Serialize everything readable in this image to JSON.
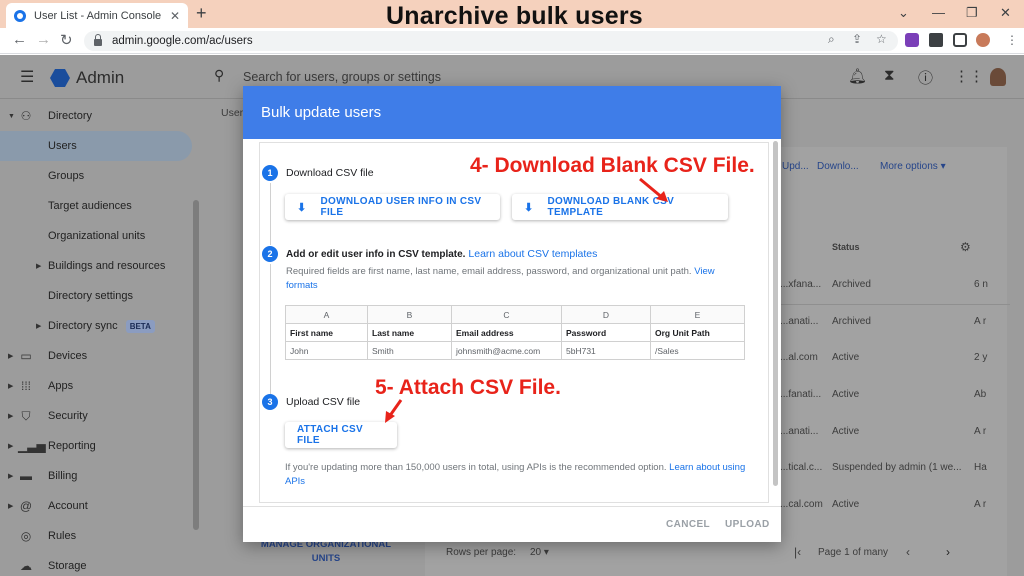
{
  "browser": {
    "tab_title": "User List - Admin Console",
    "new_tab": "+",
    "url": "admin.google.com/ac/users",
    "headline": "Unarchive bulk users",
    "win_min": "⌄",
    "win_minimize": "—",
    "win_restore": "❐",
    "win_close": "✕",
    "tab_close": "✕"
  },
  "admin": {
    "brand": "Admin",
    "search_placeholder": "Search for users, groups or settings"
  },
  "sidebar": {
    "items": [
      {
        "label": "Directory"
      },
      {
        "label": "Users"
      },
      {
        "label": "Groups"
      },
      {
        "label": "Target audiences"
      },
      {
        "label": "Organizational units"
      },
      {
        "label": "Buildings and resources"
      },
      {
        "label": "Directory settings"
      },
      {
        "label": "Directory sync",
        "badge": "BETA"
      },
      {
        "label": "Devices"
      },
      {
        "label": "Apps"
      },
      {
        "label": "Security"
      },
      {
        "label": "Reporting"
      },
      {
        "label": "Billing"
      },
      {
        "label": "Account"
      },
      {
        "label": "Rules"
      },
      {
        "label": "Storage"
      }
    ]
  },
  "background": {
    "users_tab": "User",
    "upd": "Upd...",
    "downlo": "Downlo...",
    "more_options": "More options",
    "status_header": "Status",
    "rows": [
      {
        "email": "...xfana...",
        "status": "Archived",
        "last": "6 n"
      },
      {
        "email": "...anati...",
        "status": "Archived",
        "last": "A r"
      },
      {
        "email": "...al.com",
        "status": "Active",
        "last": "2 y"
      },
      {
        "email": "...fanati...",
        "status": "Active",
        "last": "Ab"
      },
      {
        "email": "...anati...",
        "status": "Active",
        "last": "A r"
      },
      {
        "email": "...tical.c...",
        "status": "Suspended by admin (1 we...",
        "last": "Ha"
      },
      {
        "email": "...cal.com",
        "status": "Active",
        "last": "A r"
      }
    ],
    "manage_ou": "MANAGE ORGANIZATIONAL UNITS",
    "rows_per_page_label": "Rows per page:",
    "rows_per_page_value": "20",
    "pagination": "Page 1 of many"
  },
  "dialog": {
    "title": "Bulk update users",
    "step1": {
      "number": "1",
      "title": "Download CSV file",
      "btn_user_info": "DOWNLOAD USER INFO IN CSV FILE",
      "btn_blank": "DOWNLOAD BLANK CSV TEMPLATE"
    },
    "step2": {
      "number": "2",
      "title": "Add or edit user info in CSV template.",
      "link": "Learn about CSV templates",
      "required_text": "Required fields are first name, last name, email address, password, and organizational unit path.",
      "view_link": "View",
      "formats_link": "formats",
      "table": {
        "letters": [
          "A",
          "B",
          "C",
          "D",
          "E"
        ],
        "headers": [
          "First name",
          "Last name",
          "Email address",
          "Password",
          "Org Unit Path"
        ],
        "sample": [
          "John",
          "Smith",
          "johnsmith@acme.com",
          "5bH731",
          "/Sales"
        ]
      }
    },
    "step3": {
      "number": "3",
      "title": "Upload CSV file",
      "btn_attach": "ATTACH CSV FILE",
      "api_text": "If you're updating more than 150,000 users in total, using APIs is the recommended option.",
      "api_link": "Learn about using",
      "api_link2": "APIs"
    },
    "cancel": "CANCEL",
    "upload": "UPLOAD"
  },
  "annotations": {
    "download_blank": "4- Download Blank CSV File.",
    "attach": "5- Attach CSV File."
  },
  "colors": {
    "accent": "#1a73e8",
    "dialog_header": "#3f7de8",
    "annotation": "#e8231a",
    "tabbar": "#f5d1bd"
  }
}
